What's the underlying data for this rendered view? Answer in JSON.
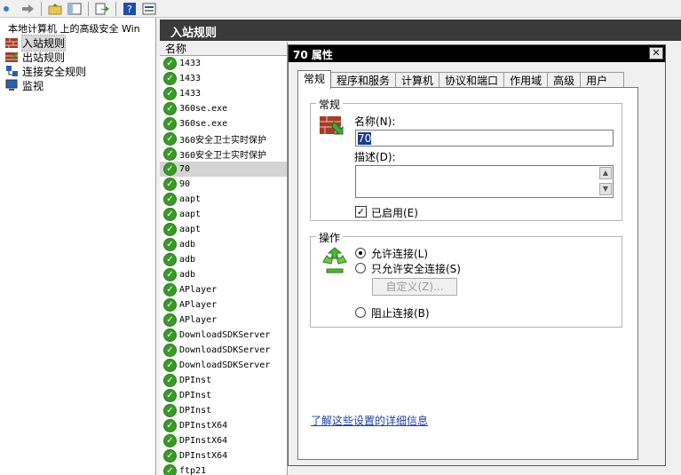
{
  "toolbar": {
    "buttons": [
      "forward-icon",
      "up-folder-icon",
      "show-hide-tree-icon",
      "export-icon",
      "help-icon",
      "properties-icon"
    ]
  },
  "tree": {
    "root": "本地计算机 上的高级安全 Win",
    "items": [
      {
        "label": "入站规则",
        "icon": "inbound-rules-icon"
      },
      {
        "label": "出站规则",
        "icon": "outbound-rules-icon"
      },
      {
        "label": "连接安全规则",
        "icon": "connection-security-icon"
      },
      {
        "label": "监视",
        "icon": "monitor-icon"
      }
    ]
  },
  "center": {
    "title": "入站规则",
    "column_header": "名称",
    "rows": [
      "1433",
      "1433",
      "1433",
      "360se.exe",
      "360se.exe",
      "360安全卫士实时保护",
      "360安全卫士实时保护",
      "70",
      "90",
      "aapt",
      "aapt",
      "aapt",
      "adb",
      "adb",
      "adb",
      "APlayer",
      "APlayer",
      "APlayer",
      "DownloadSDKServer",
      "DownloadSDKServer",
      "DownloadSDKServer",
      "DPInst",
      "DPInst",
      "DPInst",
      "DPInstX64",
      "DPInstX64",
      "DPInstX64",
      "ftp21"
    ],
    "selected_index": 7
  },
  "dialog": {
    "title": "70 属性",
    "close": "✕",
    "tabs": [
      "常规",
      "程序和服务",
      "计算机",
      "协议和端口",
      "作用域",
      "高级",
      "用户"
    ],
    "active_tab": 0,
    "general_group": "常规",
    "name_label": "名称(N):",
    "name_value": "70",
    "desc_label": "描述(D):",
    "desc_value": "",
    "enabled_label": "已启用(E)",
    "enabled": true,
    "action_group": "操作",
    "allow_label": "允许连接(L)",
    "allow_secure_label": "只允许安全连接(S)",
    "custom_button": "自定义(Z)...",
    "block_label": "阻止连接(B)",
    "selected_action": "allow",
    "help_link": "了解这些设置的详细信息"
  }
}
